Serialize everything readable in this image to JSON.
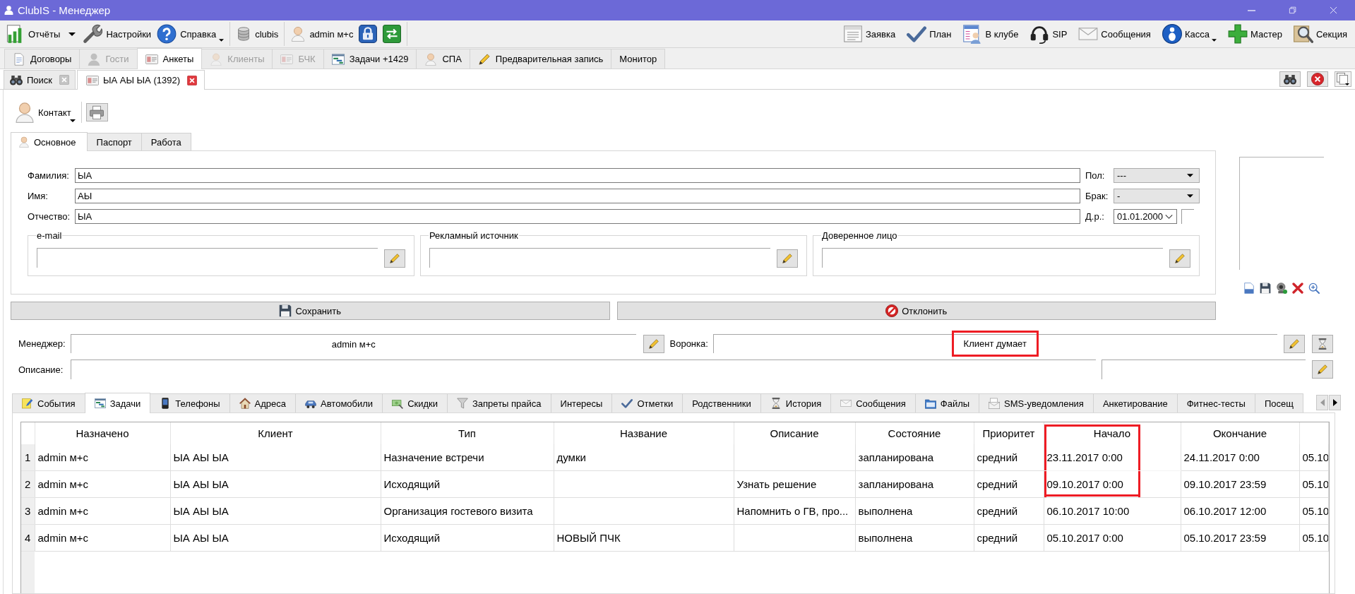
{
  "window": {
    "title": "ClubIS - Менеджер"
  },
  "toolbar": {
    "groups": [
      {
        "items": [
          {
            "kind": "split",
            "label": "Отчёты"
          },
          {
            "kind": "button",
            "label": "Настройки"
          },
          {
            "kind": "menu",
            "label": "Справка"
          }
        ]
      },
      {
        "items": [
          {
            "kind": "button",
            "label": "clubis"
          }
        ]
      },
      {
        "items": [
          {
            "kind": "button",
            "label": "admin м+с"
          },
          {
            "kind": "icon"
          },
          {
            "kind": "icon"
          }
        ]
      }
    ],
    "right_items": [
      {
        "kind": "button",
        "label": "Заявка"
      },
      {
        "kind": "button",
        "label": "План"
      },
      {
        "kind": "button",
        "label": "В клубе"
      },
      {
        "kind": "button",
        "label": "SIP"
      },
      {
        "kind": "button",
        "label": "Сообщения"
      },
      {
        "kind": "menu",
        "label": "Касса"
      },
      {
        "kind": "button",
        "label": "Мастер"
      },
      {
        "kind": "button",
        "label": "Секция"
      }
    ]
  },
  "module_tabs": [
    {
      "label": "Договоры",
      "selected": false,
      "disabled": false
    },
    {
      "label": "Гости",
      "selected": false,
      "disabled": true
    },
    {
      "label": "Анкеты",
      "selected": true,
      "disabled": false
    },
    {
      "label": "Клиенты",
      "selected": false,
      "disabled": true
    },
    {
      "label": "БЧК",
      "selected": false,
      "disabled": true
    },
    {
      "label": "Задачи +1429",
      "selected": false,
      "disabled": false
    },
    {
      "label": "СПА",
      "selected": false,
      "disabled": false
    },
    {
      "label": "Предварительная запись",
      "selected": false,
      "disabled": false
    },
    {
      "label": "Монитор",
      "selected": false,
      "disabled": false
    }
  ],
  "document_tabs": [
    {
      "label": "Поиск",
      "selected": false
    },
    {
      "label": "ЫА АЫ ЫА (1392)",
      "selected": true
    }
  ],
  "contact_button": {
    "label": "Контакт"
  },
  "form_tabs": [
    {
      "label": "Основное",
      "selected": true
    },
    {
      "label": "Паспорт",
      "selected": false
    },
    {
      "label": "Работа",
      "selected": false
    }
  ],
  "name_fields": [
    {
      "label": "Фамилия:",
      "value": "ЫА"
    },
    {
      "label": "Имя:",
      "value": "АЫ"
    },
    {
      "label": "Отчество:",
      "value": "ЫА"
    }
  ],
  "side_fields": [
    {
      "kind": "select",
      "label": "Пол:",
      "value": "---"
    },
    {
      "kind": "select",
      "label": "Брак:",
      "value": "-"
    },
    {
      "kind": "date",
      "label": "Д.р.:",
      "value": "01.01.2000"
    }
  ],
  "groups": [
    {
      "title": "e-mail"
    },
    {
      "title": "Рекламный источник"
    },
    {
      "title": "Доверенное лицо"
    }
  ],
  "actions": [
    {
      "label": "Сохранить"
    },
    {
      "label": "Отклонить"
    }
  ],
  "manager": {
    "label": "Менеджер:",
    "value": "admin м+с"
  },
  "funnel": {
    "label": "Воронка:",
    "value": "Клиент думает",
    "highlighted": true
  },
  "description": {
    "label": "Описание:"
  },
  "detail_tabs": [
    {
      "label": "События",
      "selected": false
    },
    {
      "label": "Задачи",
      "selected": true
    },
    {
      "label": "Телефоны",
      "selected": false
    },
    {
      "label": "Адреса",
      "selected": false
    },
    {
      "label": "Автомобили",
      "selected": false
    },
    {
      "label": "Скидки",
      "selected": false
    },
    {
      "label": "Запреты прайса",
      "selected": false
    },
    {
      "label": "Интересы",
      "selected": false
    },
    {
      "label": "Отметки",
      "selected": false
    },
    {
      "label": "Родственники",
      "selected": false
    },
    {
      "label": "История",
      "selected": false
    },
    {
      "label": "Сообщения",
      "selected": false
    },
    {
      "label": "Файлы",
      "selected": false
    },
    {
      "label": "SMS-уведомления",
      "selected": false
    },
    {
      "label": "Анкетирование",
      "selected": false
    },
    {
      "label": "Фитнес-тесты",
      "selected": false
    },
    {
      "label": "Посещ",
      "selected": false
    }
  ],
  "table": {
    "columns": [
      {
        "label": "Назначено",
        "highlighted": false
      },
      {
        "label": "Клиент",
        "highlighted": false
      },
      {
        "label": "Тип",
        "highlighted": false
      },
      {
        "label": "Название",
        "highlighted": false
      },
      {
        "label": "Описание",
        "highlighted": false
      },
      {
        "label": "Состояние",
        "highlighted": false
      },
      {
        "label": "Приоритет",
        "highlighted": false
      },
      {
        "label": "Начало",
        "highlighted": true
      },
      {
        "label": "Окончание",
        "highlighted": false
      }
    ],
    "rows": [
      {
        "number": "1",
        "assigned_to": "admin м+с",
        "client": "ЫА АЫ ЫА",
        "type": "Назначение встречи",
        "title": "думки",
        "state": "запланирована",
        "priority": "средний",
        "start": "23.11.2017 0:00",
        "end": "24.11.2017 0:00",
        "column_10": "05.10",
        "highlighted": true
      },
      {
        "number": "2",
        "assigned_to": "admin м+с",
        "client": "ЫА АЫ ЫА",
        "type": "Исходящий",
        "description": "Узнать решение",
        "state": "запланирована",
        "priority": "средний",
        "start": "09.10.2017 0:00",
        "end": "09.10.2017 23:59",
        "column_10": "05.10",
        "highlighted": true
      },
      {
        "number": "3",
        "assigned_to": "admin м+с",
        "client": "ЫА АЫ ЫА",
        "type": "Организация гостевого визита",
        "description": "Напомнить о ГВ, про...",
        "state": "выполнена",
        "priority": "средний",
        "start": "06.10.2017 10:00",
        "end": "06.10.2017 12:00",
        "column_10": "05.10",
        "highlighted": false
      },
      {
        "number": "4",
        "assigned_to": "admin м+с",
        "client": "ЫА АЫ ЫА",
        "type": "Исходящий",
        "title": "НОВЫЙ ПЧК",
        "state": "выполнена",
        "priority": "средний",
        "start": "05.10.2017 0:00",
        "end": "05.10.2017 23:59",
        "column_10": "05.10",
        "highlighted": false
      }
    ]
  }
}
